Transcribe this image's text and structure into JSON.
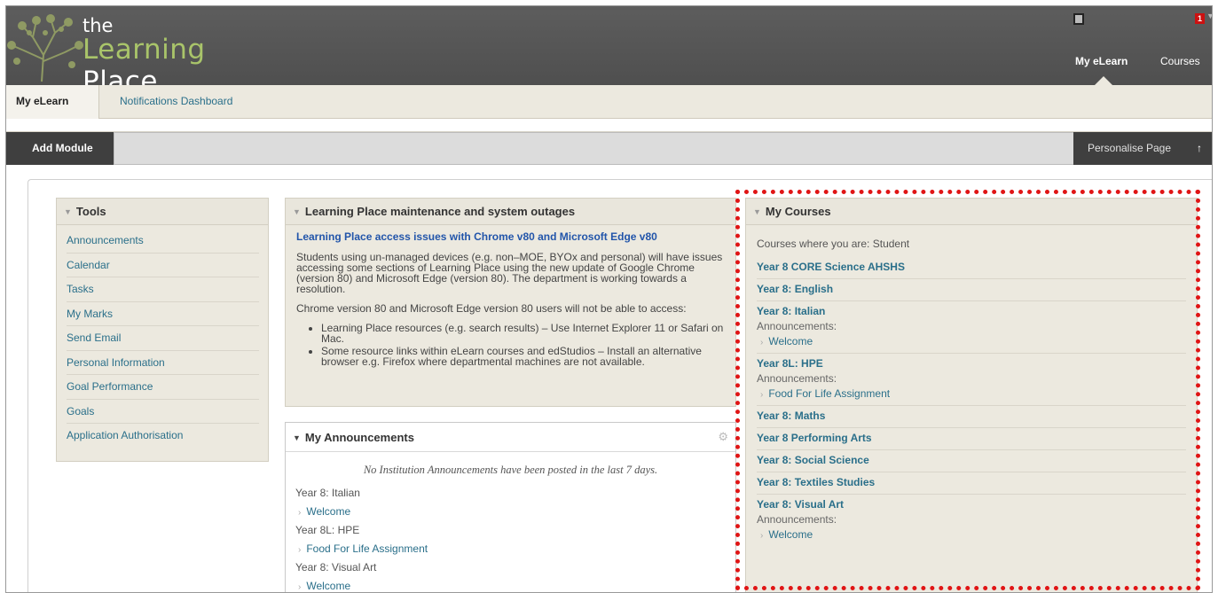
{
  "header": {
    "logo_the": "the",
    "logo_first": "Learning",
    "logo_second": "Place",
    "notification_count": "1",
    "nav": {
      "my_elearn": "My eLearn",
      "courses": "Courses"
    },
    "brand_color": "#5a5a5a",
    "accent_color": "#a9c46a"
  },
  "tabs": {
    "my_elearn": "My eLearn",
    "notifications": "Notifications Dashboard"
  },
  "module_bar": {
    "add_module": "Add Module",
    "personalise": "Personalise Page",
    "sort_glyph": "↑"
  },
  "tools": {
    "title": "Tools",
    "items": [
      "Announcements",
      "Calendar",
      "Tasks",
      "My Marks",
      "Send Email",
      "Personal Information",
      "Goal Performance",
      "Goals",
      "Application Authorisation"
    ]
  },
  "maintenance": {
    "title": "Learning Place maintenance and system outages",
    "link": "Learning Place access issues with Chrome v80 and Microsoft Edge v80",
    "p1": "Students using un-managed devices (e.g. non–MOE, BYOx and personal) will have issues accessing some sections of Learning Place using the new update of Google Chrome (version 80) and Microsoft Edge (version 80). The department is working towards a resolution.",
    "p2": "Chrome version 80 and Microsoft Edge version 80 users will not be able to access:",
    "bullets": [
      "Learning Place resources (e.g. search results) – Use Internet Explorer 11 or Safari on Mac.",
      "Some resource links within eLearn courses and edStudios – Install an alternative browser e.g. Firefox where departmental machines are not available."
    ]
  },
  "announcements": {
    "title": "My Announcements",
    "none_msg": "No Institution Announcements have been posted in the last 7 days.",
    "entries": [
      {
        "course": "Year 8: Italian",
        "item": "Welcome"
      },
      {
        "course": "Year 8L: HPE",
        "item": "Food For Life Assignment"
      },
      {
        "course": "Year 8: Visual Art",
        "item": "Welcome"
      }
    ]
  },
  "courses": {
    "title": "My Courses",
    "subtitle": "Courses where you are: Student",
    "announcements_label": "Announcements:",
    "list": [
      {
        "name": "Year 8 CORE Science AHSHS"
      },
      {
        "name": "Year 8: English"
      },
      {
        "name": "Year 8: Italian",
        "announcement": "Welcome"
      },
      {
        "name": "Year 8L: HPE",
        "announcement": "Food For Life Assignment"
      },
      {
        "name": "Year 8: Maths"
      },
      {
        "name": "Year 8 Performing Arts"
      },
      {
        "name": "Year 8: Social Science"
      },
      {
        "name": "Year 8: Textiles Studies"
      },
      {
        "name": "Year 8: Visual Art",
        "announcement": "Welcome"
      }
    ]
  },
  "colors": {
    "link": "#2a6f8a",
    "highlight": "#e01515",
    "panel": "#ece9df"
  }
}
